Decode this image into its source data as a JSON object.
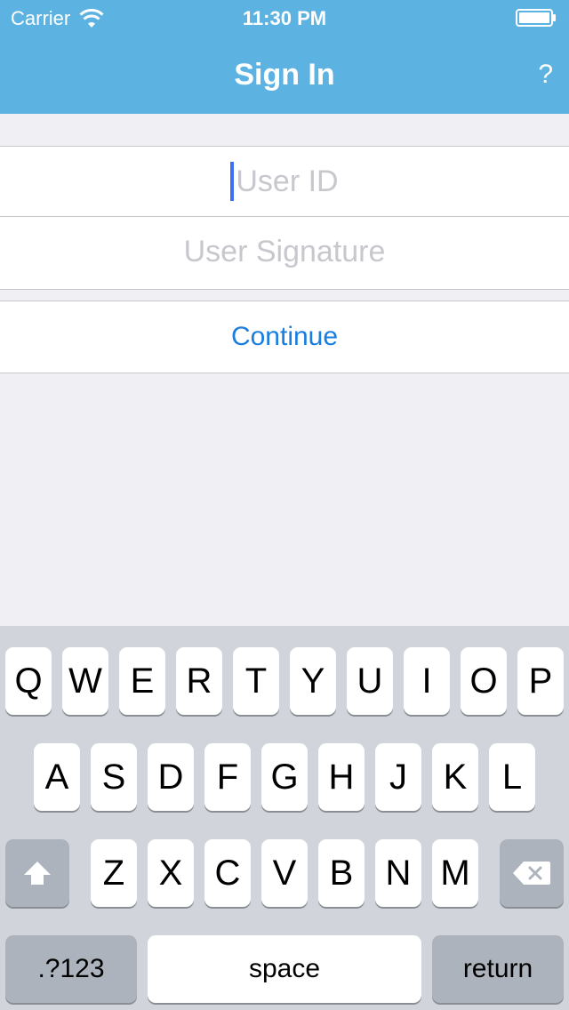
{
  "status_bar": {
    "carrier": "Carrier",
    "time": "11:30 PM",
    "wifi_icon": "wifi-icon",
    "battery_icon": "battery-icon"
  },
  "nav": {
    "title": "Sign In",
    "help_label": "?"
  },
  "form": {
    "user_id_placeholder": "User ID",
    "user_id_value": "",
    "signature_placeholder": "User Signature",
    "signature_value": "",
    "continue_label": "Continue"
  },
  "keyboard": {
    "row1": [
      "Q",
      "W",
      "E",
      "R",
      "T",
      "Y",
      "U",
      "I",
      "O",
      "P"
    ],
    "row2": [
      "A",
      "S",
      "D",
      "F",
      "G",
      "H",
      "J",
      "K",
      "L"
    ],
    "row3": [
      "Z",
      "X",
      "C",
      "V",
      "B",
      "N",
      "M"
    ],
    "shift_icon": "shift-icon",
    "delete_icon": "delete-icon",
    "numbers_label": ".?123",
    "space_label": "space",
    "return_label": "return"
  },
  "colors": {
    "nav_background": "#5cb3e2",
    "accent": "#1a7de0",
    "caret": "#3f6ef5",
    "placeholder": "#c7c7cd",
    "background": "#efeff4",
    "keyboard_background": "#d1d5db"
  }
}
